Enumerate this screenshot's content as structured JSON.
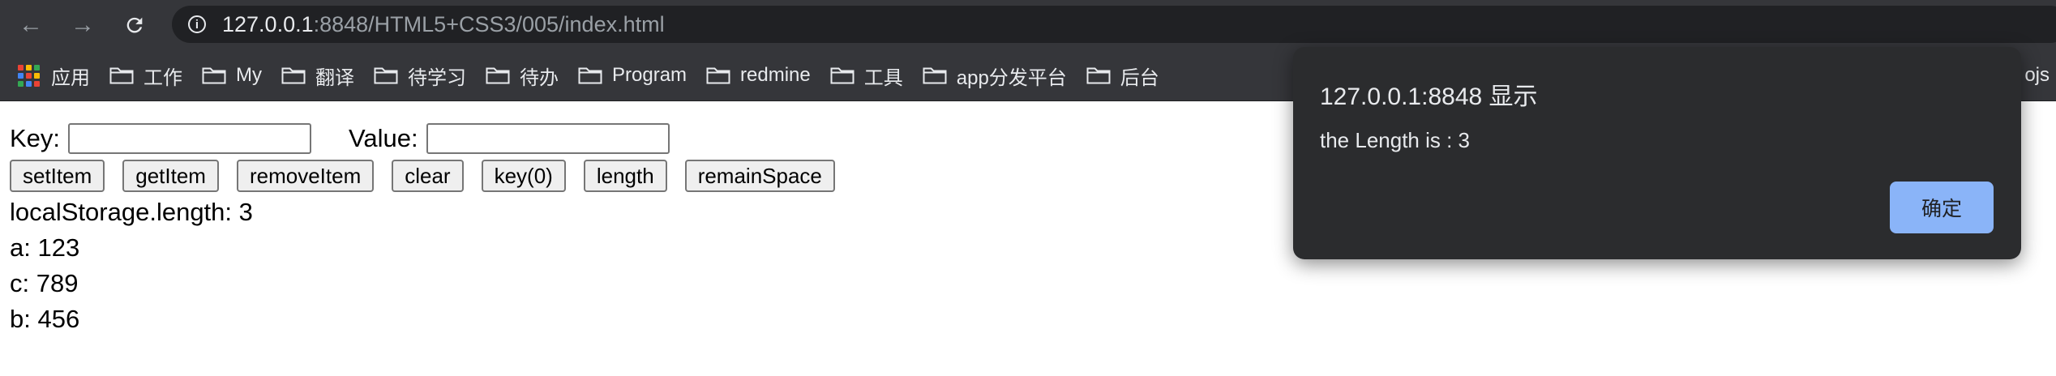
{
  "browser": {
    "url_host": "127.0.0.1",
    "url_rest": ":8848/HTML5+CSS3/005/index.html",
    "bookmarks": [
      {
        "label": "应用",
        "icon": "apps-grid-icon"
      },
      {
        "label": "工作",
        "icon": "folder-icon"
      },
      {
        "label": "My",
        "icon": "folder-icon"
      },
      {
        "label": "翻译",
        "icon": "folder-icon"
      },
      {
        "label": "待学习",
        "icon": "folder-icon"
      },
      {
        "label": "待办",
        "icon": "folder-icon"
      },
      {
        "label": "Program",
        "icon": "folder-icon"
      },
      {
        "label": "redmine",
        "icon": "folder-icon"
      },
      {
        "label": "工具",
        "icon": "folder-icon"
      },
      {
        "label": "app分发平台",
        "icon": "folder-icon"
      },
      {
        "label": "后台",
        "icon": "folder-icon"
      }
    ],
    "bookmark_tail": "ojs"
  },
  "page": {
    "key_label": "Key:",
    "key_value": "",
    "value_label": "Value:",
    "value_value": "",
    "buttons": [
      "setItem",
      "getItem",
      "removeItem",
      "clear",
      "key(0)",
      "length",
      "remainSpace"
    ],
    "output": [
      "localStorage.length: 3",
      "a: 123",
      "c: 789",
      "b: 456"
    ]
  },
  "dialog": {
    "title": "127.0.0.1:8848 显示",
    "message": "the Length is : 3",
    "ok_label": "确定"
  },
  "colors": {
    "chrome_bg": "#35363a",
    "omnibox_bg": "#202124",
    "dialog_bg": "#2b2c2e",
    "dialog_button": "#8ab4f8"
  }
}
